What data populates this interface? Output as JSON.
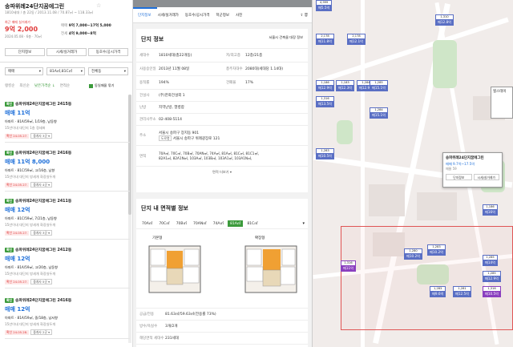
{
  "left": {
    "title": "송파위례24단지꿈에그린",
    "subtitle": "1810세대 / 총 22동 / 2013.11.08 / 70.87㎡ ~ 118.33㎡",
    "trade_label": "최근 매매 실거래가",
    "trade_price": "9억 2,000",
    "trade_date": "2024.05.08 · 6층 · 70㎡",
    "sale_label": "매매",
    "sale_range": "9억 7,000~17억 5,000",
    "rent_label": "전세",
    "rent_range": "4억 9,000~8억",
    "buttons": [
      "단지정보",
      "시세/실거래가",
      "동호수/공시가격"
    ],
    "filters": {
      "type": "매매",
      "area": "81A㎡,81C㎡",
      "dong": "전체동"
    },
    "sort": {
      "items": [
        "랭킹순",
        "최신순",
        "낮은가격순 ↓",
        "면적순"
      ],
      "check_label": "동일매물 묶기"
    },
    "listings": [
      {
        "badge": "확인",
        "name": "송파위례24단지꿈에그린 2415동",
        "price": "매매 11억",
        "spec": "아파트 · 81A/59㎡, 1/19층, 남동향",
        "desc": "15년이내 대단지 1층 정세퍼",
        "tag": "확인 24.05.27.",
        "agent": "중개사 3곳 ▾"
      },
      {
        "badge": "확인",
        "name": "송파위례24단지꿈에그린 2416동",
        "price": "매매 11억 8,000",
        "spec": "아파트 · 81C/59㎡, 고/16층, 남향",
        "desc": "15년이내 대단지 방세개 화장실두개",
        "tag": "확인 24.05.27.",
        "agent": "중개사 4곳 ▾"
      },
      {
        "badge": "확인",
        "name": "송파위례24단지꿈에그린 2411동",
        "price": "매매 12억",
        "spec": "아파트 · 81C/59㎡, 7/21층, 남동향",
        "desc": "15년이내 대단지 방세개 화장실두개",
        "tag": "확인 24.05.27.",
        "agent": "중개사 3곳 ▾"
      },
      {
        "badge": "확인",
        "name": "송파위례24단지꿈에그린 2412동",
        "price": "매매 12억",
        "spec": "아파트 · 81A/59㎡, 고/20층, 남동향",
        "desc": "15년이내 대단지 방세개 화장실두개",
        "tag": "확인 24.05.27.",
        "agent": "중개사 5곳 ▾"
      },
      {
        "badge": "확인",
        "name": "송파위례24단지꿈에그린 2416동",
        "price": "매매 12억",
        "spec": "아파트 · 81A/59㎡, 중/18층, 남서향",
        "desc": "15년이내 대단지 방세개 화장실두개",
        "tag": "확인 24.05.28.",
        "agent": "중개사 2곳 ▾"
      }
    ]
  },
  "mid": {
    "tabs": [
      "단지정보",
      "시세/실거래가",
      "동호수/공시가격",
      "학군정보",
      "사진"
    ],
    "section_title": "단지 정보",
    "link": "서울시 건축물 대장 정보",
    "rows": [
      {
        "k1": "세대수",
        "v1": "1810세대(총22개동)",
        "k2": "저/최고층",
        "v2": "12층/21층"
      },
      {
        "k1": "사용승인일",
        "v1": "2013년 11월 08일",
        "k2": "총주차대수",
        "v2": "2080대(세대당 1.14대)"
      },
      {
        "k1": "용적률",
        "v1": "194%",
        "k2": "건폐율",
        "v2": "17%"
      }
    ],
    "builder_k": "건설사",
    "builder_v": "(주)한화건설외 1",
    "heat_k": "난방",
    "heat_v": "지역난방, 열병합",
    "office_k": "관리사무소",
    "office_v": "02-408-5114",
    "addr_k": "주소",
    "addr_v1": "서울시 송파구 장지동 901",
    "addr_road": "도로명",
    "addr_v2": "서울시 송파구 위례광장로 121",
    "area_k": "면적",
    "area_v1": "70A㎡, 70C㎡, 70B㎡, 70AN㎡, 74A㎡, 81A㎡, 81C㎡, 81C1㎡,",
    "area_v2": "82A1㎡, 82A1N㎡, 103A㎡, 103B㎡, 103A1㎡, 103A1N㎡,",
    "area_more": "면적 더보기 ▾",
    "area_title": "단지 내 면적별 정보",
    "area_tabs": [
      "70A㎡",
      "70C㎡",
      "70B㎡",
      "70AN㎡",
      "74A㎡",
      "81A㎡",
      "81C㎡"
    ],
    "plan1": "기본형",
    "plan2": "확장형",
    "supply_k": "공급/전용",
    "supply_v": "81.63㎡/59.63㎡(전용률 73%)",
    "room_k": "방수/욕실수",
    "room_v": "3개/2개",
    "households_k": "해당면적 세대수",
    "households_v": "231세대"
  },
  "map": {
    "popup_title": "송파위례24단지꿈에그린",
    "popup_price": "매매 9.7억~17.5억",
    "popup_count": "매물 59",
    "popup_btn1": "단지정보",
    "popup_btn2": "시세/실거래가",
    "side_label": "힐스테이",
    "markers": [
      {
        "top": "4,999",
        "price": "매5.5억",
        "cls": ""
      },
      {
        "top": "1,310",
        "price": "매12.8억",
        "cls": ""
      },
      {
        "top": "2,178",
        "price": "매12.1억",
        "cls": ""
      },
      {
        "top": "2,178",
        "price": "매11.8억",
        "cls": ""
      },
      {
        "top": "1,186",
        "price": "매12.9억",
        "cls": ""
      },
      {
        "top": "1,183",
        "price": "매12.3억",
        "cls": ""
      },
      {
        "top": "1,284",
        "price": "매12.9억",
        "cls": ""
      },
      {
        "top": "1,285",
        "price": "매15.1억",
        "cls": ""
      },
      {
        "top": "1,316",
        "price": "매13.5억",
        "cls": ""
      },
      {
        "top": "1,284",
        "price": "매15.1억",
        "cls": ""
      },
      {
        "top": "1,186",
        "price": "매16억",
        "cls": ""
      },
      {
        "top": "1,283",
        "price": "매10.2억",
        "cls": ""
      },
      {
        "top": "1,285",
        "price": "매14억",
        "cls": ""
      },
      {
        "top": "1,285",
        "price": "매12.9억",
        "cls": ""
      },
      {
        "top": "1,283",
        "price": "매9.6억",
        "cls": ""
      },
      {
        "top": "1,281",
        "price": "매12.5억",
        "cls": ""
      },
      {
        "top": "1,283",
        "price": "매10.5억",
        "cls": ""
      },
      {
        "top": "1,316",
        "price": "매10.5억",
        "cls": "mkp"
      },
      {
        "top": "1,280",
        "price": "매10.2억",
        "cls": ""
      },
      {
        "top": "1,316",
        "price": "매11억",
        "cls": "mkp"
      }
    ]
  }
}
